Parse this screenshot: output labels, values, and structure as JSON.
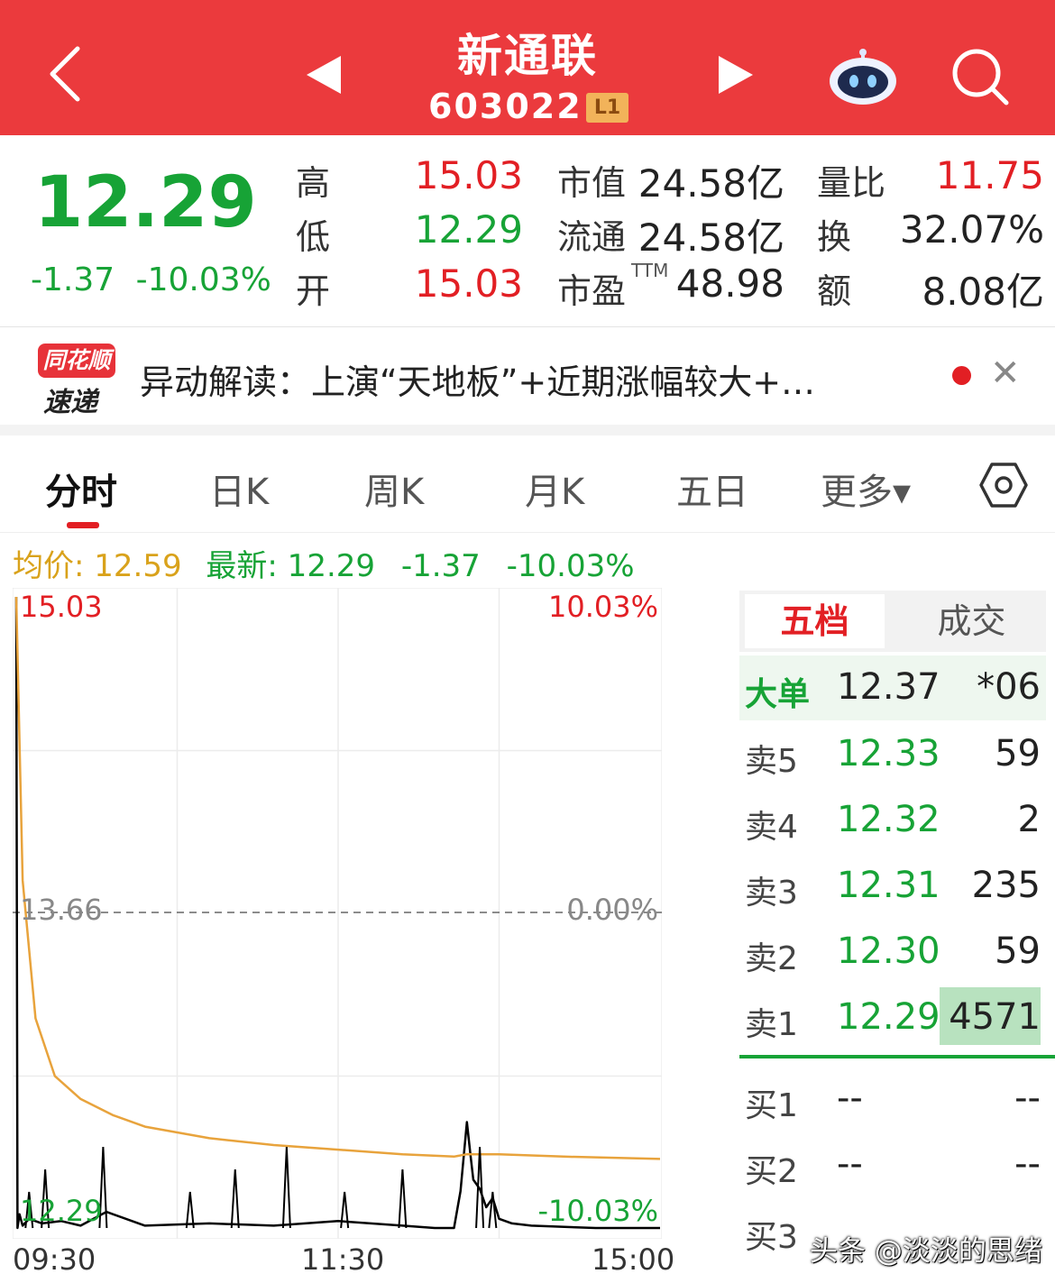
{
  "header": {
    "title": "新通联",
    "code": "603022",
    "level_badge": "L1",
    "bg_color": "#eb3a3d"
  },
  "quote": {
    "price": "12.29",
    "change": "-1.37",
    "change_pct": "-10.03%",
    "fields": {
      "high_label": "高",
      "high": "15.03",
      "low_label": "低",
      "low": "12.29",
      "open_label": "开",
      "open": "15.03",
      "mktcap_label": "市值",
      "mktcap": "24.58亿",
      "float_label": "流通",
      "float": "24.58亿",
      "pe_label": "市盈",
      "pe_sup": "TTM",
      "pe": "48.98",
      "volratio_label": "量比",
      "volratio": "11.75",
      "turnover_label": "换",
      "turnover": "32.07%",
      "amount_label": "额",
      "amount": "8.08亿"
    },
    "colors": {
      "up": "#e21f24",
      "down": "#17a336"
    }
  },
  "news": {
    "logo_top": "同花顺",
    "logo_bottom": "速递",
    "text": "异动解读：上演“天地板”+近期涨幅较大+…"
  },
  "tabs": [
    {
      "label": "分时",
      "active": true
    },
    {
      "label": "日K"
    },
    {
      "label": "周K"
    },
    {
      "label": "月K"
    },
    {
      "label": "五日"
    },
    {
      "label": "更多▾"
    }
  ],
  "info_line": {
    "avg": "均价: 12.59",
    "last": "最新: 12.29",
    "change": "-1.37",
    "change_pct": "-10.03%"
  },
  "chart_data": {
    "type": "line",
    "y_top_label": "15.03",
    "y_mid_label": "13.66",
    "y_bottom_label": "12.29",
    "pct_top_label": "10.03%",
    "pct_mid_label": "0.00%",
    "pct_bottom_label": "-10.03%",
    "x_labels": [
      "09:30",
      "11:30",
      "15:00"
    ],
    "ylim": [
      12.29,
      15.03
    ],
    "prev_close": 13.66,
    "series": [
      {
        "name": "price",
        "color": "#000000",
        "t": [
          0,
          0.002,
          0.005,
          0.01,
          0.02,
          0.04,
          0.07,
          0.1,
          0.14,
          0.2,
          0.3,
          0.4,
          0.5,
          0.6,
          0.65,
          0.68,
          0.69,
          0.7,
          0.705,
          0.71,
          0.72,
          0.73,
          0.74,
          0.75,
          0.77,
          0.8,
          0.9,
          1.0
        ],
        "v": [
          15.03,
          12.29,
          12.35,
          12.3,
          12.33,
          12.31,
          12.32,
          12.3,
          12.36,
          12.3,
          12.31,
          12.3,
          12.32,
          12.3,
          12.29,
          12.29,
          12.45,
          12.75,
          12.62,
          12.5,
          12.46,
          12.38,
          12.42,
          12.33,
          12.31,
          12.3,
          12.29,
          12.29
        ]
      },
      {
        "name": "avg",
        "color": "#e8a33c",
        "t": [
          0,
          0.01,
          0.03,
          0.06,
          0.1,
          0.15,
          0.2,
          0.3,
          0.4,
          0.5,
          0.6,
          0.68,
          0.7,
          0.75,
          0.85,
          1.0
        ],
        "v": [
          15.03,
          13.8,
          13.2,
          12.95,
          12.85,
          12.78,
          12.73,
          12.68,
          12.65,
          12.63,
          12.61,
          12.6,
          12.61,
          12.61,
          12.6,
          12.59
        ]
      }
    ],
    "volume_spikes": [
      0.02,
      0.045,
      0.135,
      0.27,
      0.34,
      0.42,
      0.51,
      0.6,
      0.72,
      0.74
    ]
  },
  "orderbook": {
    "tab_a": "五档",
    "tab_b": "成交",
    "big": {
      "label": "大单",
      "price": "12.37",
      "vol": "*06"
    },
    "asks": [
      {
        "label": "卖5",
        "price": "12.33",
        "vol": "59"
      },
      {
        "label": "卖4",
        "price": "12.32",
        "vol": "2"
      },
      {
        "label": "卖3",
        "price": "12.31",
        "vol": "235"
      },
      {
        "label": "卖2",
        "price": "12.30",
        "vol": "59"
      },
      {
        "label": "卖1",
        "price": "12.29",
        "vol": "4571"
      }
    ],
    "bids": [
      {
        "label": "买1",
        "price": "--",
        "vol": "--"
      },
      {
        "label": "买2",
        "price": "--",
        "vol": "--"
      },
      {
        "label": "买3",
        "price": "",
        "vol": ""
      }
    ]
  },
  "watermark": "头条 @淡淡的思绪"
}
